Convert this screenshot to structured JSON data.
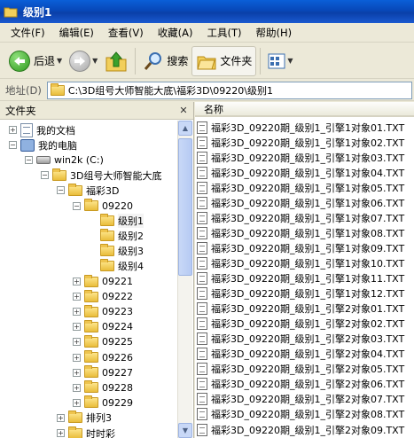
{
  "window": {
    "title": "级别1"
  },
  "menu": [
    "文件(F)",
    "编辑(E)",
    "查看(V)",
    "收藏(A)",
    "工具(T)",
    "帮助(H)"
  ],
  "toolbar": {
    "back": "后退",
    "search": "搜索",
    "folders": "文件夹"
  },
  "address": {
    "label": "地址(D)",
    "path": "C:\\3D组号大师智能大底\\福彩3D\\09220\\级别1"
  },
  "left_pane": {
    "header": "文件夹"
  },
  "tree": [
    {
      "label": "我的文档",
      "level": 0,
      "expander": "+",
      "icon": "documents-icon"
    },
    {
      "label": "我的电脑",
      "level": 0,
      "expander": "-",
      "icon": "computer-icon"
    },
    {
      "label": "win2k (C:)",
      "level": 1,
      "expander": "-",
      "icon": "drive-icon"
    },
    {
      "label": "3D组号大师智能大底",
      "level": 2,
      "expander": "-",
      "icon": "folder-icon"
    },
    {
      "label": "福彩3D",
      "level": 3,
      "expander": "-",
      "icon": "folder-icon"
    },
    {
      "label": "09220",
      "level": 4,
      "expander": "-",
      "icon": "folder-icon"
    },
    {
      "label": "级别1",
      "level": 5,
      "expander": "",
      "icon": "folder-icon",
      "selected": true
    },
    {
      "label": "级别2",
      "level": 5,
      "expander": "",
      "icon": "folder-icon"
    },
    {
      "label": "级别3",
      "level": 5,
      "expander": "",
      "icon": "folder-icon"
    },
    {
      "label": "级别4",
      "level": 5,
      "expander": "",
      "icon": "folder-icon"
    },
    {
      "label": "09221",
      "level": 4,
      "expander": "+",
      "icon": "folder-icon"
    },
    {
      "label": "09222",
      "level": 4,
      "expander": "+",
      "icon": "folder-icon"
    },
    {
      "label": "09223",
      "level": 4,
      "expander": "+",
      "icon": "folder-icon"
    },
    {
      "label": "09224",
      "level": 4,
      "expander": "+",
      "icon": "folder-icon"
    },
    {
      "label": "09225",
      "level": 4,
      "expander": "+",
      "icon": "folder-icon"
    },
    {
      "label": "09226",
      "level": 4,
      "expander": "+",
      "icon": "folder-icon"
    },
    {
      "label": "09227",
      "level": 4,
      "expander": "+",
      "icon": "folder-icon"
    },
    {
      "label": "09228",
      "level": 4,
      "expander": "+",
      "icon": "folder-icon"
    },
    {
      "label": "09229",
      "level": 4,
      "expander": "+",
      "icon": "folder-icon"
    },
    {
      "label": "排列3",
      "level": 3,
      "expander": "+",
      "icon": "folder-icon"
    },
    {
      "label": "时时彩",
      "level": 3,
      "expander": "+",
      "icon": "folder-icon"
    }
  ],
  "right_pane": {
    "column_name": "名称"
  },
  "files": [
    "福彩3D_09220期_级别1_引擎1对象01.TXT",
    "福彩3D_09220期_级别1_引擎1对象02.TXT",
    "福彩3D_09220期_级别1_引擎1对象03.TXT",
    "福彩3D_09220期_级别1_引擎1对象04.TXT",
    "福彩3D_09220期_级别1_引擎1对象05.TXT",
    "福彩3D_09220期_级别1_引擎1对象06.TXT",
    "福彩3D_09220期_级别1_引擎1对象07.TXT",
    "福彩3D_09220期_级别1_引擎1对象08.TXT",
    "福彩3D_09220期_级别1_引擎1对象09.TXT",
    "福彩3D_09220期_级别1_引擎1对象10.TXT",
    "福彩3D_09220期_级别1_引擎1对象11.TXT",
    "福彩3D_09220期_级别1_引擎1对象12.TXT",
    "福彩3D_09220期_级别1_引擎2对象01.TXT",
    "福彩3D_09220期_级别1_引擎2对象02.TXT",
    "福彩3D_09220期_级别1_引擎2对象03.TXT",
    "福彩3D_09220期_级别1_引擎2对象04.TXT",
    "福彩3D_09220期_级别1_引擎2对象05.TXT",
    "福彩3D_09220期_级别1_引擎2对象06.TXT",
    "福彩3D_09220期_级别1_引擎2对象07.TXT",
    "福彩3D_09220期_级别1_引擎2对象08.TXT",
    "福彩3D_09220期_级别1_引擎2对象09.TXT"
  ]
}
